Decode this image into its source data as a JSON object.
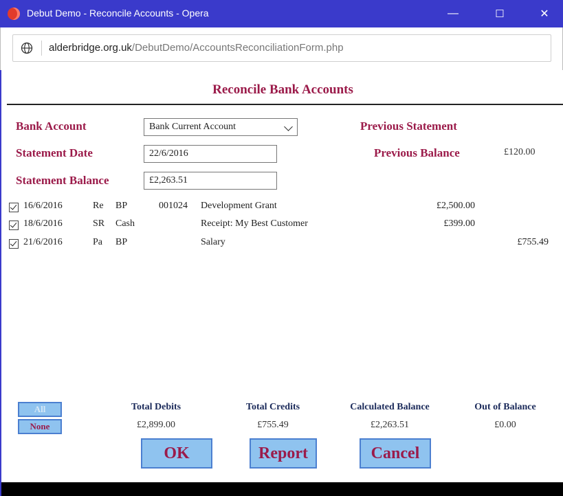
{
  "window": {
    "title": "Debut Demo - Reconcile Accounts - Opera",
    "minimize": "—",
    "maximize": "☐",
    "close": "✕"
  },
  "address": {
    "domain": "alderbridge.org.uk",
    "path": "/DebutDemo/AccountsReconciliationForm.php"
  },
  "page": {
    "heading": "Reconcile Bank Accounts"
  },
  "form": {
    "bank_account_label": "Bank Account",
    "bank_account_value": "Bank Current Account",
    "statement_date_label": "Statement Date",
    "statement_date_value": "22/6/2016",
    "statement_balance_label": "Statement Balance",
    "statement_balance_value": "£2,263.51",
    "previous_statement_label": "Previous Statement",
    "previous_balance_label": "Previous Balance",
    "previous_balance_value": "£120.00"
  },
  "transactions": [
    {
      "checked": true,
      "date": "16/6/2016",
      "type": "Re",
      "method": "BP",
      "ref": "001024",
      "description": "Development Grant",
      "debit": "£2,500.00",
      "credit": ""
    },
    {
      "checked": true,
      "date": "18/6/2016",
      "type": "SR",
      "method": "Cash",
      "ref": "",
      "description": "Receipt: My Best Customer",
      "debit": "£399.00",
      "credit": ""
    },
    {
      "checked": true,
      "date": "21/6/2016",
      "type": "Pa",
      "method": "BP",
      "ref": "",
      "description": "Salary",
      "debit": "",
      "credit": "£755.49"
    }
  ],
  "selection": {
    "all_label": "All",
    "none_label": "None"
  },
  "totals": {
    "debits_label": "Total Debits",
    "debits_value": "£2,899.00",
    "credits_label": "Total Credits",
    "credits_value": "£755.49",
    "calc_label": "Calculated Balance",
    "calc_value": "£2,263.51",
    "oob_label": "Out of Balance",
    "oob_value": "£0.00"
  },
  "actions": {
    "ok": "OK",
    "report": "Report",
    "cancel": "Cancel"
  },
  "colors": {
    "titlebar": "#3a3acb",
    "label": "#9b1b4a",
    "button_fill": "#8fc3ef",
    "button_border": "#4b7fd0"
  }
}
